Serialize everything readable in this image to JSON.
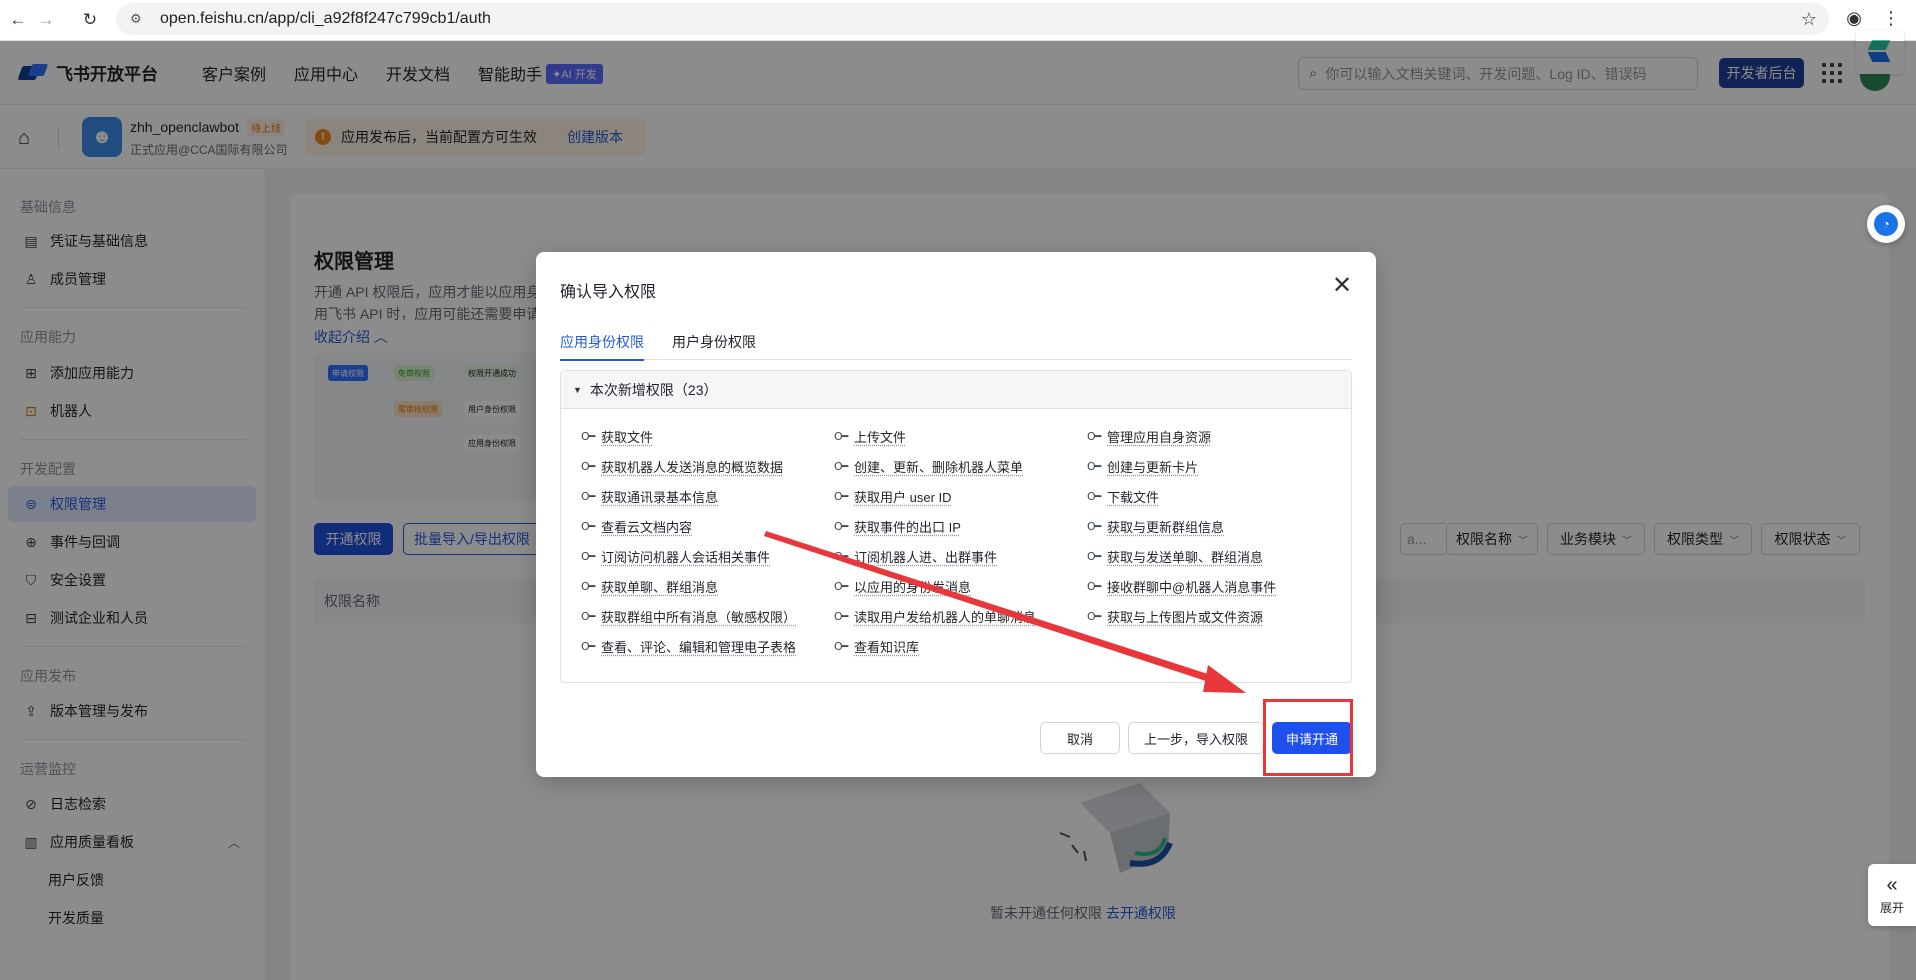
{
  "browser": {
    "url": "open.feishu.cn/app/cli_a92f8f247c799cb1/auth"
  },
  "header": {
    "brand": "飞书开放平台",
    "nav": [
      "客户案例",
      "应用中心",
      "开发文档",
      "智能助手"
    ],
    "ai_badge": "✦AI 开发",
    "search_placeholder": "你可以输入文档关键词、开发问题、Log ID、错误码",
    "dev_console": "开发者后台"
  },
  "app": {
    "name": "zhh_openclawbot",
    "status": "待上线",
    "subtitle": "正式应用@CCA国际有限公司",
    "notice": "应用发布后，当前配置方可生效",
    "notice_link": "创建版本"
  },
  "sidebar": {
    "groups": [
      {
        "title": "基础信息",
        "items": [
          "凭证与基础信息",
          "成员管理"
        ]
      },
      {
        "title": "应用能力",
        "items": [
          "添加应用能力",
          "机器人"
        ]
      },
      {
        "title": "开发配置",
        "items": [
          "权限管理",
          "事件与回调",
          "安全设置",
          "测试企业和人员"
        ]
      },
      {
        "title": "应用发布",
        "items": [
          "版本管理与发布"
        ]
      },
      {
        "title": "运营监控",
        "items": [
          "日志检索",
          "应用质量看板",
          "用户反馈",
          "开发质量"
        ]
      }
    ],
    "active": "权限管理"
  },
  "main": {
    "title": "权限管理",
    "desc_line1": "开通 API 权限后，应用才能以应用身",
    "desc_line2": "用飞书 API 时，应用可能还需要申请",
    "collapse": "收起介绍",
    "flow": {
      "chip1": "申请权限",
      "chip2": "免审权限",
      "chip3": "权限开通成功",
      "chip4": "需审核权限",
      "chip5": "用户身份权限",
      "chip6": "应用身份权限"
    },
    "btn_open": "开通权限",
    "btn_batch": "批量导入/导出权限",
    "filter_placeholder": "a...",
    "filters": [
      "权限名称",
      "业务模块",
      "权限类型",
      "权限状态"
    ],
    "table_header": "权限名称",
    "empty_text": "暂未开通任何权限",
    "empty_link": "去开通权限"
  },
  "floating": {
    "expand_label": "展开"
  },
  "modal": {
    "title": "确认导入权限",
    "tabs": [
      "应用身份权限",
      "用户身份权限"
    ],
    "active_tab": "应用身份权限",
    "section_title": "本次新增权限（23）",
    "permissions": [
      "获取文件",
      "上传文件",
      "管理应用自身资源",
      "获取机器人发送消息的概览数据",
      "创建、更新、删除机器人菜单",
      "创建与更新卡片",
      "获取通讯录基本信息",
      "获取用户 user ID",
      "下载文件",
      "查看云文档内容",
      "获取事件的出口 IP",
      "获取与更新群组信息",
      "订阅访问机器人会话相关事件",
      "订阅机器人进、出群事件",
      "获取与发送单聊、群组消息",
      "获取单聊、群组消息",
      "以应用的身份发消息",
      "接收群聊中@机器人消息事件",
      "获取群组中所有消息（敏感权限）",
      "读取用户发给机器人的单聊消息",
      "获取与上传图片或文件资源",
      "查看、评论、编辑和管理电子表格",
      "查看知识库"
    ],
    "btn_cancel": "取消",
    "btn_prev": "上一步，导入权限",
    "btn_apply": "申请开通"
  },
  "colors": {
    "primary": "#245bdb",
    "apply_button": "#1f50ee",
    "annotation_red": "#e8373b"
  }
}
